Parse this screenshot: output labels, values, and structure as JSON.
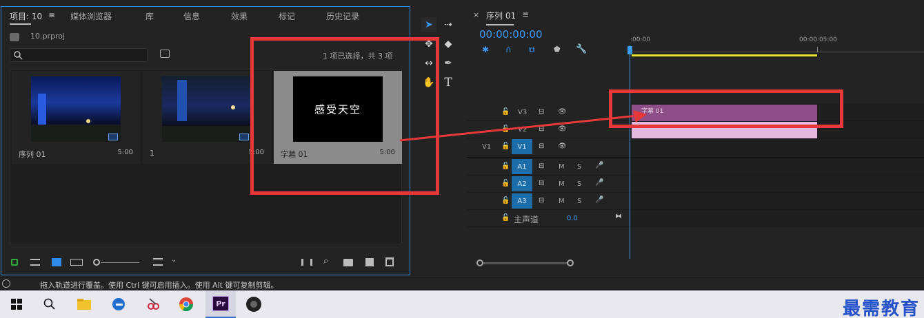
{
  "project_panel": {
    "tabs": [
      "项目: 10",
      "媒体浏览器",
      "库",
      "信息",
      "效果",
      "标记",
      "历史记录"
    ],
    "menu_glyph": "≡",
    "file_name": "10.prproj",
    "selection_info": "1 项已选择，共 3 项",
    "items": [
      {
        "label": "序列 01",
        "duration": "5:00"
      },
      {
        "label": "1",
        "duration": "5:00"
      },
      {
        "label": "字幕 01",
        "duration": "5:00",
        "title_text": "感受天空"
      }
    ]
  },
  "timeline": {
    "tab_close": "×",
    "tab_title": "序列 01",
    "menu_glyph": "≡",
    "timecode": "00:00:00:00",
    "ruler_start": ":00:00",
    "ruler_mark": "00:00:05:00",
    "video_tracks": [
      {
        "name": "V3",
        "source": ""
      },
      {
        "name": "V2",
        "source": ""
      },
      {
        "name": "V1",
        "source": "V1"
      }
    ],
    "audio_tracks": [
      {
        "name": "A1",
        "m": "M",
        "s": "S"
      },
      {
        "name": "A2",
        "m": "M",
        "s": "S"
      },
      {
        "name": "A3",
        "m": "M",
        "s": "S"
      }
    ],
    "master_label": "主声道",
    "master_value": "0.0",
    "clip_label": "字幕 01"
  },
  "status_text": "拖入轨道进行覆盖。使用 Ctrl 键可启用插入。使用 Alt 键可复制剪辑。",
  "taskbar": {
    "premiere_label": "Pr",
    "watermark": "最需教育"
  },
  "colors": {
    "accent_blue": "#2d8ceb",
    "highlight_red": "#e8383a",
    "clip_purple": "#8d4f86",
    "clip_pink": "#e5b9de",
    "timecode_blue": "#3b9bff",
    "work_area_yellow": "#e5e52a"
  }
}
